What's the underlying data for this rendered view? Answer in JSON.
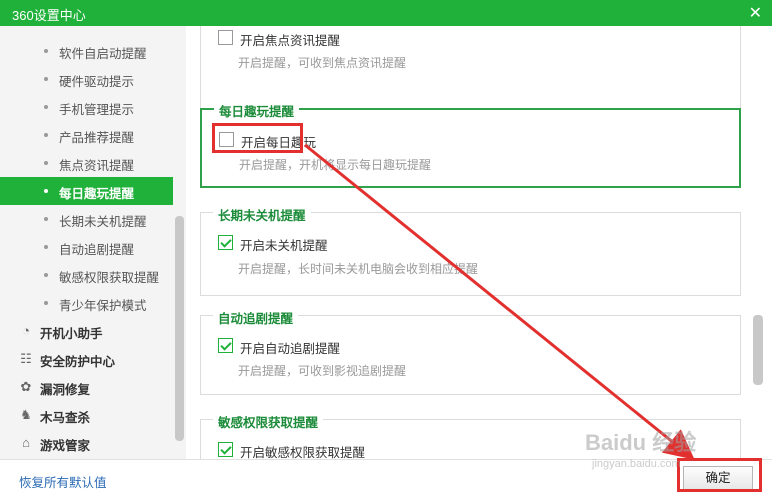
{
  "window": {
    "title": "360设置中心",
    "close_glyph": "✕"
  },
  "sidebar": {
    "sub_items": [
      {
        "label": "软件自启动提醒",
        "active": false
      },
      {
        "label": "硬件驱动提示",
        "active": false
      },
      {
        "label": "手机管理提示",
        "active": false
      },
      {
        "label": "产品推荐提醒",
        "active": false
      },
      {
        "label": "焦点资讯提醒",
        "active": false
      },
      {
        "label": "每日趣玩提醒",
        "active": true
      },
      {
        "label": "长期未关机提醒",
        "active": false
      },
      {
        "label": "自动追剧提醒",
        "active": false
      },
      {
        "label": "敏感权限获取提醒",
        "active": false
      },
      {
        "label": "青少年保护模式",
        "active": false
      }
    ],
    "categories": [
      {
        "label": "开机小助手",
        "icon": "clock-icon",
        "glyph": "◔"
      },
      {
        "label": "安全防护中心",
        "icon": "grid-icon",
        "glyph": "☷"
      },
      {
        "label": "漏洞修复",
        "icon": "bug-icon",
        "glyph": "✿"
      },
      {
        "label": "木马查杀",
        "icon": "horse-icon",
        "glyph": "♞"
      },
      {
        "label": "游戏管家",
        "icon": "gamepad-icon",
        "glyph": "⌂"
      }
    ]
  },
  "sections": {
    "focus": {
      "option": "开启焦点资讯提醒",
      "checked": false,
      "desc": "开启提醒，可收到焦点资讯提醒"
    },
    "daily_fun": {
      "title": "每日趣玩提醒",
      "option": "开启每日趣玩",
      "checked": false,
      "desc": "开启提醒，开机将显示每日趣玩提醒"
    },
    "long_on": {
      "title": "长期未关机提醒",
      "option": "开启未关机提醒",
      "checked": true,
      "desc": "开启提醒，长时间未关机电脑会收到相应提醒"
    },
    "auto_drama": {
      "title": "自动追剧提醒",
      "option": "开启自动追剧提醒",
      "checked": true,
      "desc": "开启提醒，可收到影视追剧提醒"
    },
    "sensitive": {
      "title": "敏感权限获取提醒",
      "option": "开启敏感权限获取提醒",
      "checked": true
    }
  },
  "footer": {
    "restore_label": "恢复所有默认值",
    "ok_label": "确定"
  },
  "watermark": {
    "brand": "Baidu 经验",
    "url": "jingyan.baidu.com"
  },
  "colors": {
    "brand_green": "#1fb13a",
    "annotation_red": "#e2302f",
    "link_blue": "#2a6ab4"
  }
}
